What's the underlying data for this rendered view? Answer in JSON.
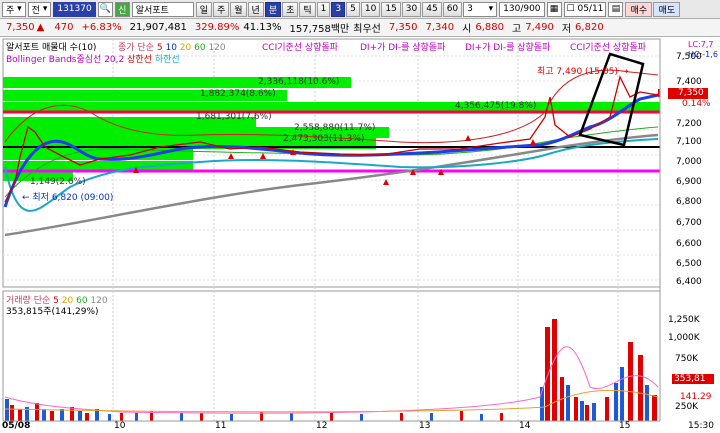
{
  "toolbar1": {
    "market_label": "주",
    "type_label": "전",
    "code": "131370",
    "credit_badge": "신",
    "name": "알서포트",
    "periods": [
      "일",
      "주",
      "월",
      "년",
      "분",
      "초",
      "틱"
    ],
    "intervals": [
      "1",
      "3",
      "5",
      "10",
      "15",
      "30",
      "45",
      "60"
    ],
    "count_value": "3",
    "count_range": "130/900",
    "date": "05/11",
    "buy_label": "매수",
    "sell_label": "매도"
  },
  "toolbar2": {
    "price": "7,350",
    "change": "470",
    "change_pct": "+6.83%",
    "volume": "21,907,481",
    "vol_ratio": "329.89%",
    "turnover_rate": "41.13%",
    "amount": "157,758백만",
    "quote_label": "최우선",
    "ask": "7,350",
    "bid": "7,340",
    "open_label": "시",
    "open": "6,880",
    "high_label": "고",
    "high": "7,490",
    "low_label": "저",
    "low": "6,820"
  },
  "legend_top": {
    "title": "알서포트 매물대 수(10)",
    "ma_label": "종가 단순",
    "ma": [
      "5",
      "10",
      "20",
      "60",
      "120"
    ],
    "cci": "CCI기준선 상향돌파",
    "dmi1": "DI+가 DI-를 상향돌파",
    "dmi2": "DI+가 DI-를 상향돌파",
    "cci2": "CCI기준선 상향돌파",
    "bollinger": "Bollinger Bands중심선 20,2",
    "upper": "상한선",
    "lower": "하한선",
    "lc": "LC:7,7",
    "hc": "HC:-1,6"
  },
  "legend_bottom": {
    "title": "거래량",
    "ma_label": "단순",
    "ma": [
      "5",
      "20",
      "60",
      "120"
    ],
    "last_volume": "353,815주(141,29%)"
  },
  "annotations": {
    "high": "최고 7,490 (15:05)",
    "low": "최저 6,820 (09:00)",
    "bars": [
      "2,336,118(10.6%)",
      "1,882,374(8.6%)",
      "4,356,475(19.8%)",
      "1,681,301(7.6%)",
      "2,558,880(11.7%)",
      "2,473,303(11.3%)",
      "1,149(2.6%)"
    ],
    "current_price": "7,350",
    "current_pct": "0.14%",
    "current_vol": "353,81",
    "current_vol_pct": "141.29"
  },
  "price_axis": [
    "7,500",
    "7,400",
    "7,300",
    "7,200",
    "7,100",
    "7,000",
    "6,900",
    "6,800",
    "6,700",
    "6,600",
    "6,500",
    "6,400"
  ],
  "volume_axis": [
    "1,250K",
    "1,000K",
    "750K",
    "500K",
    "250K"
  ],
  "time_axis": [
    "05/08",
    "10",
    "11",
    "12",
    "13",
    "14",
    "15",
    "15:30"
  ]
}
